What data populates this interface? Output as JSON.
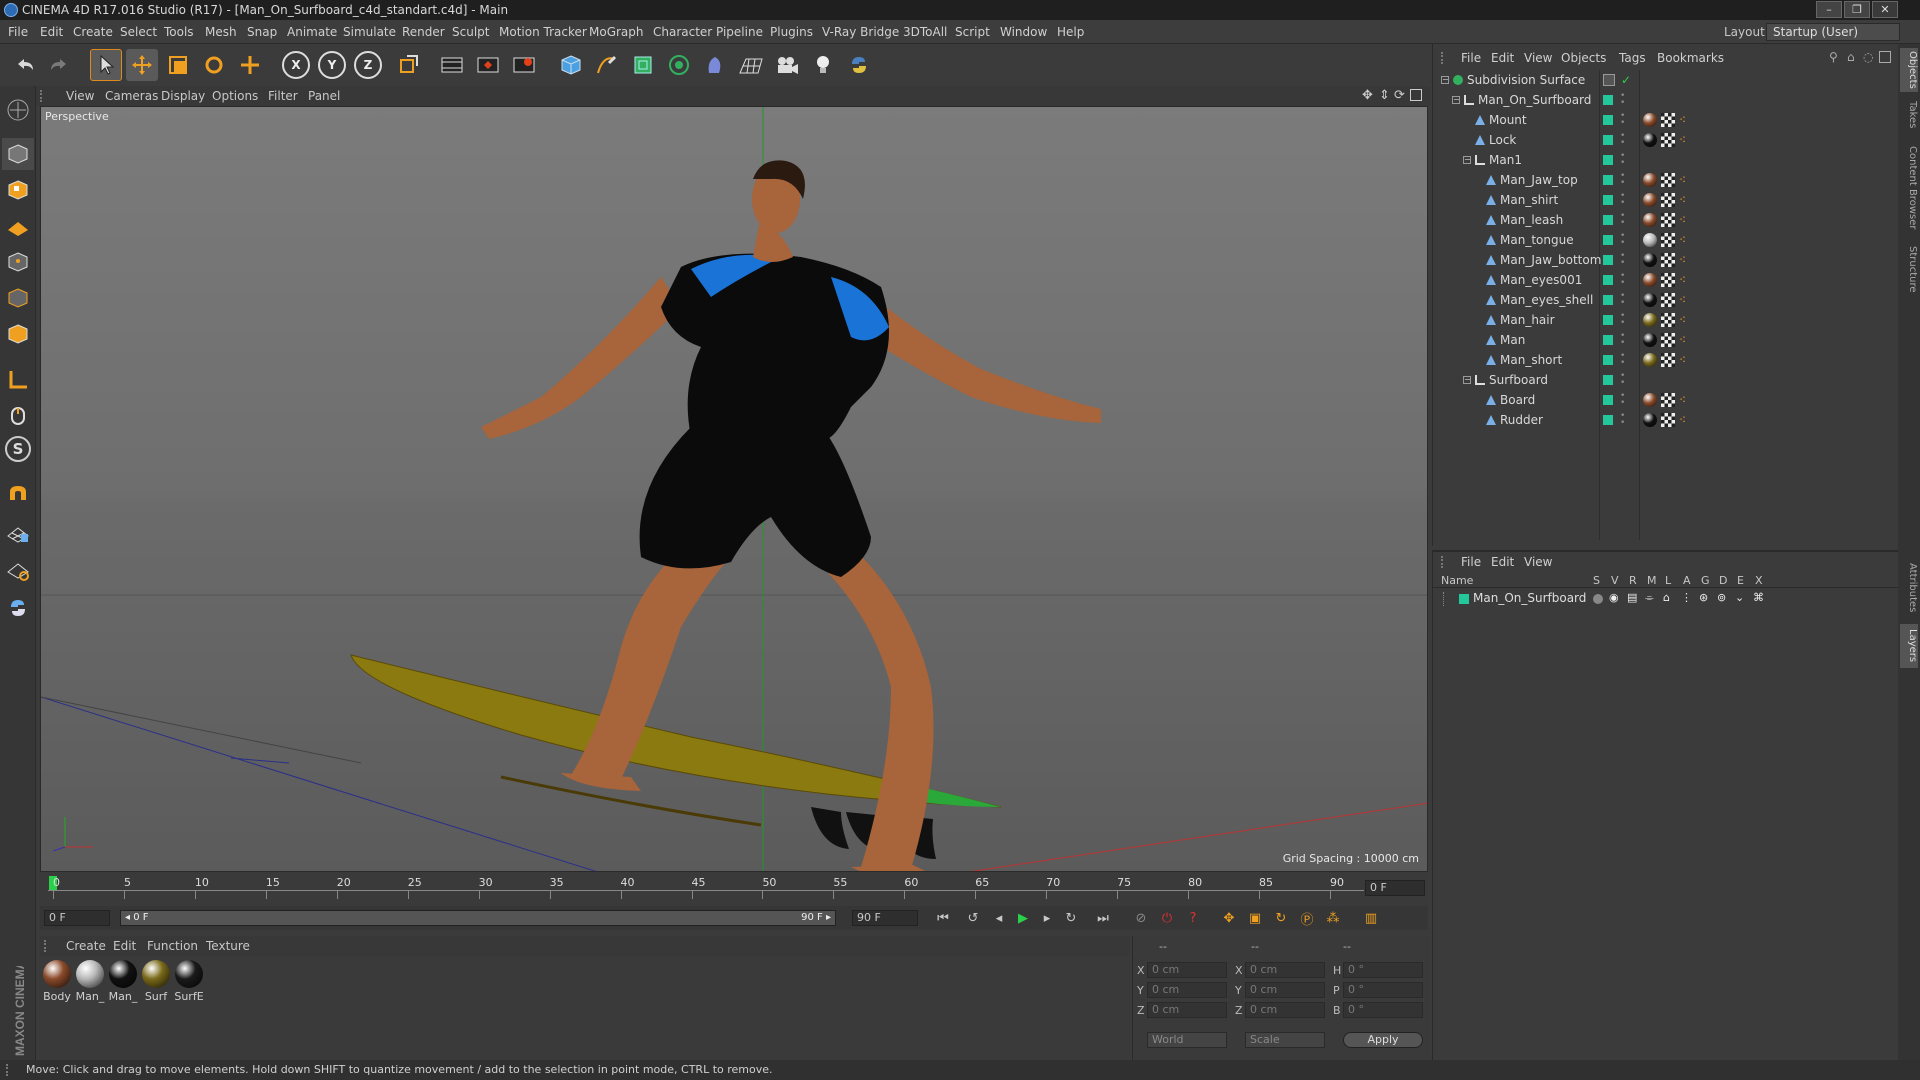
{
  "window": {
    "title": "CINEMA 4D R17.016 Studio (R17) - [Man_On_Surfboard_c4d_standart.c4d] - Main",
    "buttons": [
      "–",
      "❐",
      "✕"
    ]
  },
  "menu": {
    "items": [
      "File",
      "Edit",
      "Create",
      "Select",
      "Tools",
      "Mesh",
      "Snap",
      "Animate",
      "Simulate",
      "Render",
      "Sculpt",
      "Motion Tracker",
      "MoGraph",
      "Character",
      "Pipeline",
      "Plugins",
      "V-Ray Bridge",
      "3DToAll",
      "Script",
      "Window",
      "Help"
    ],
    "layout_label": "Layout:",
    "layout_value": "Startup (User)"
  },
  "toolbar": {
    "axis_x": "X",
    "axis_y": "Y",
    "axis_z": "Z"
  },
  "left_tools": {
    "sculpt_s": "S"
  },
  "viewport": {
    "menu": [
      "View",
      "Cameras",
      "Display",
      "Options",
      "Filter",
      "Panel"
    ],
    "label": "Perspective",
    "grid_spacing": "Grid Spacing : 10000 cm"
  },
  "timeline": {
    "ticks": [
      "0",
      "5",
      "10",
      "15",
      "20",
      "25",
      "30",
      "35",
      "40",
      "45",
      "50",
      "55",
      "60",
      "65",
      "70",
      "75",
      "80",
      "85",
      "90"
    ],
    "current_frame_field": "0 F",
    "start_field": "0 F",
    "range_start": "◂ 0 F",
    "range_end": "90 F ▸",
    "end_field": "90 F"
  },
  "materials": {
    "menu": [
      "Create",
      "Edit",
      "Function",
      "Texture"
    ],
    "items": [
      {
        "label": "Body",
        "color": "#8a4a2a"
      },
      {
        "label": "Man_",
        "color": "#b8b8b8"
      },
      {
        "label": "Man_",
        "color": "#111111"
      },
      {
        "label": "Surf",
        "color": "#7a6a1a"
      },
      {
        "label": "SurfE",
        "color": "#1a1a1a"
      }
    ]
  },
  "coordinates": {
    "headers": [
      "--",
      "--",
      "--"
    ],
    "rows": [
      {
        "a": "X",
        "a_val": "0 cm",
        "b": "X",
        "b_val": "0 cm",
        "c": "H",
        "c_val": "0 °"
      },
      {
        "a": "Y",
        "a_val": "0 cm",
        "b": "Y",
        "b_val": "0 cm",
        "c": "P",
        "c_val": "0 °"
      },
      {
        "a": "Z",
        "a_val": "0 cm",
        "b": "Z",
        "b_val": "0 cm",
        "c": "B",
        "c_val": "0 °"
      }
    ],
    "world": "World",
    "scale": "Scale",
    "apply": "Apply"
  },
  "status": {
    "text": "Move: Click and drag to move elements. Hold down SHIFT to quantize movement / add to the selection in point mode, CTRL to remove."
  },
  "objects": {
    "menu": [
      "File",
      "Edit",
      "View",
      "Objects",
      "Tags",
      "Bookmarks"
    ],
    "tree": [
      {
        "name": "Subdivision Surface",
        "indent": 0,
        "type": "subdiv"
      },
      {
        "name": "Man_On_Surfboard",
        "indent": 1,
        "type": "null"
      },
      {
        "name": "Mount",
        "indent": 2,
        "type": "joint"
      },
      {
        "name": "Lock",
        "indent": 2,
        "type": "joint"
      },
      {
        "name": "Man1",
        "indent": 2,
        "type": "null"
      },
      {
        "name": "Man_Jaw_top",
        "indent": 3,
        "type": "joint"
      },
      {
        "name": "Man_shirt",
        "indent": 3,
        "type": "joint"
      },
      {
        "name": "Man_leash",
        "indent": 3,
        "type": "joint"
      },
      {
        "name": "Man_tongue",
        "indent": 3,
        "type": "joint"
      },
      {
        "name": "Man_Jaw_bottom",
        "indent": 3,
        "type": "joint"
      },
      {
        "name": "Man_eyes001",
        "indent": 3,
        "type": "joint"
      },
      {
        "name": "Man_eyes_shell",
        "indent": 3,
        "type": "joint"
      },
      {
        "name": "Man_hair",
        "indent": 3,
        "type": "joint"
      },
      {
        "name": "Man",
        "indent": 3,
        "type": "joint"
      },
      {
        "name": "Man_short",
        "indent": 3,
        "type": "joint"
      },
      {
        "name": "Surfboard",
        "indent": 2,
        "type": "null"
      },
      {
        "name": "Board",
        "indent": 3,
        "type": "joint"
      },
      {
        "name": "Rudder",
        "indent": 3,
        "type": "joint"
      }
    ]
  },
  "layers": {
    "menu": [
      "File",
      "Edit",
      "View"
    ],
    "columns": [
      "Name",
      "S",
      "V",
      "R",
      "M",
      "L",
      "A",
      "G",
      "D",
      "E",
      "X"
    ],
    "rows": [
      {
        "name": "Man_On_Surfboard"
      }
    ]
  },
  "right_tabs": [
    "Objects",
    "Takes",
    "Content Browser",
    "Structure",
    "Attributes",
    "Layers"
  ],
  "branding": "MAXON CINEMA 4D"
}
